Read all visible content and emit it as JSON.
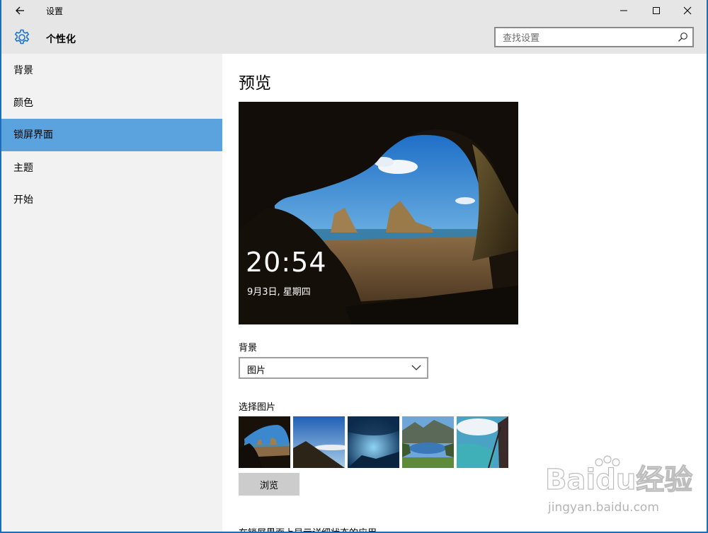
{
  "window": {
    "title": "设置"
  },
  "header": {
    "title": "个性化",
    "search_placeholder": "查找设置"
  },
  "sidebar": {
    "items": [
      {
        "label": "背景"
      },
      {
        "label": "颜色"
      },
      {
        "label": "锁屏界面",
        "active": true
      },
      {
        "label": "主题"
      },
      {
        "label": "开始"
      }
    ]
  },
  "main": {
    "title": "预览",
    "preview": {
      "time": "20:54",
      "date": "9月3日, 星期四"
    },
    "background_label": "背景",
    "background_value": "图片",
    "choose_picture_label": "选择图片",
    "thumbnails": [
      {
        "name": "cave-beach"
      },
      {
        "name": "mountain-sky"
      },
      {
        "name": "ice-cave"
      },
      {
        "name": "mountain-lake"
      },
      {
        "name": "coast-aerial"
      }
    ],
    "browse_label": "浏览",
    "next_heading_cut": "在锁屏界面上显示详细状态的应用"
  },
  "colors": {
    "accent": "#5aa3df",
    "chrome": "#e6e6e6",
    "sidebar": "#f2f2f2"
  },
  "watermark": {
    "brand": "Baidu经验",
    "url": "jingyan.baidu.com"
  }
}
